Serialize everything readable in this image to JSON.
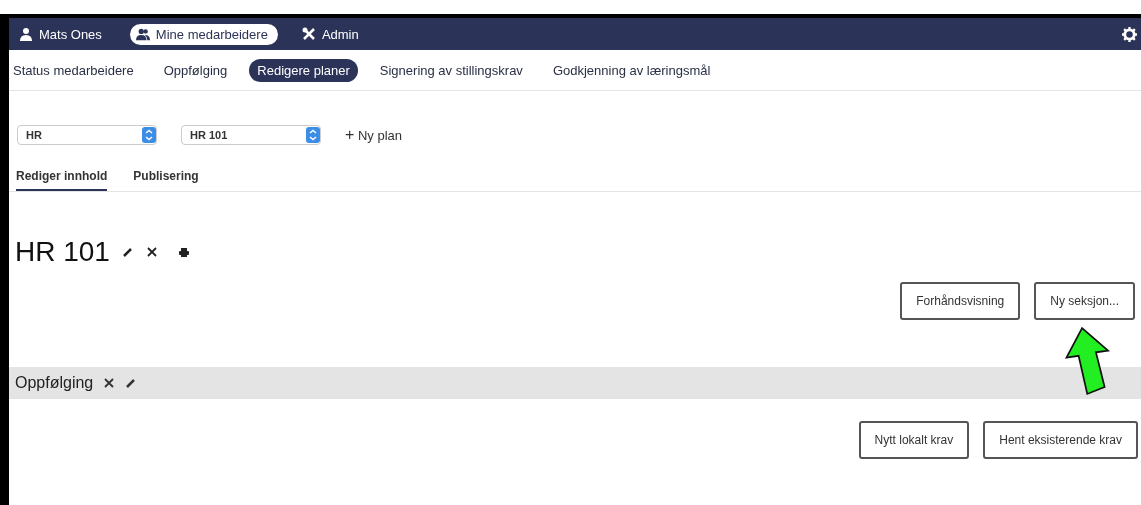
{
  "top_nav": [
    {
      "label": "Mats Ones",
      "kind": "user",
      "selected": false
    },
    {
      "label": "Mine medarbeidere",
      "kind": "users",
      "selected": true
    },
    {
      "label": "Admin",
      "kind": "tools",
      "selected": false
    }
  ],
  "sub_nav": [
    {
      "label": "Status medarbeidere",
      "selected": false
    },
    {
      "label": "Oppfølging",
      "selected": false
    },
    {
      "label": "Redigere planer",
      "selected": true
    },
    {
      "label": "Signering av stillingskrav",
      "selected": false
    },
    {
      "label": "Godkjenning av læringsmål",
      "selected": false
    }
  ],
  "selects": [
    {
      "value": "HR"
    },
    {
      "value": "HR 101"
    }
  ],
  "new_plan": {
    "icon": "+",
    "label": "Ny plan"
  },
  "tabs": [
    {
      "label": "Rediger innhold",
      "selected": true
    },
    {
      "label": "Publisering",
      "selected": false
    }
  ],
  "plan": {
    "title": "HR 101",
    "buttons": [
      "Forhåndsvisning",
      "Ny seksjon..."
    ]
  },
  "section": {
    "title": "Oppfølging",
    "buttons": [
      "Nytt lokalt krav",
      "Hent eksisterende krav"
    ]
  }
}
